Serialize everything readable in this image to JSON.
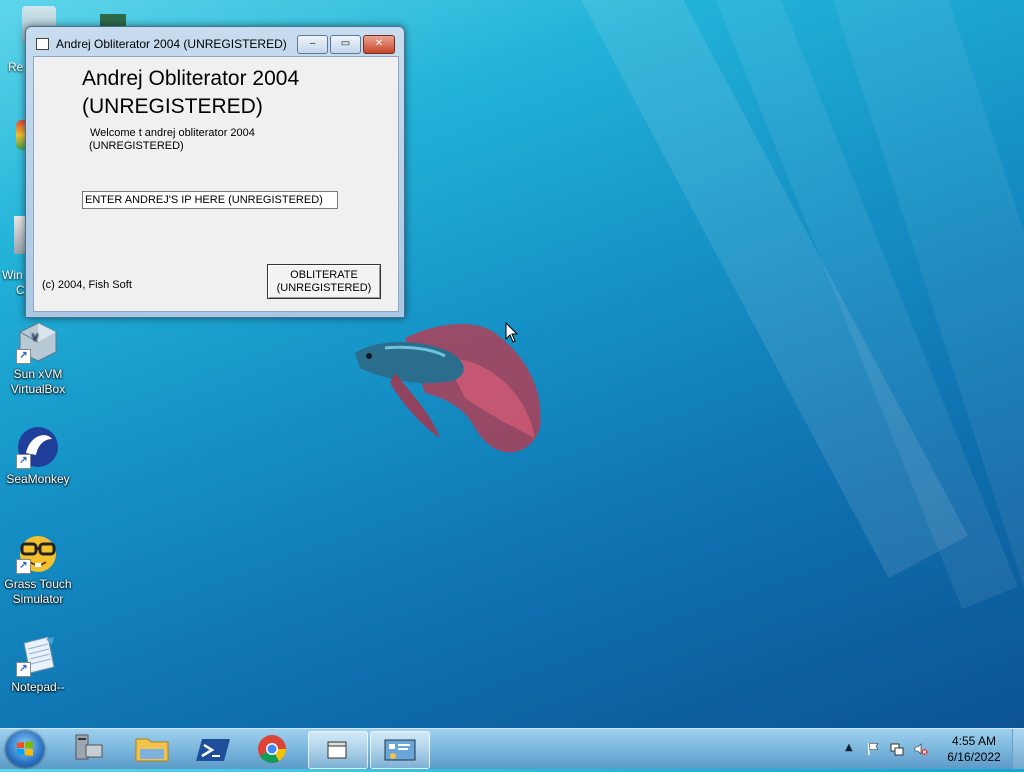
{
  "window": {
    "title": "Andrej Obliterator 2004 (UNREGISTERED)",
    "heading_line1": "Andrej Obliterator 2004",
    "heading_line2": "(UNREGISTERED)",
    "welcome_line1": "Welcome t andrej obliterator 2004",
    "welcome_line2": "(UNREGISTERED)",
    "ip_input_value": "ENTER ANDREJ'S IP HERE (UNREGISTERED)",
    "copyright": "(c) 2004, Fish Soft",
    "button_line1": "OBLITERATE",
    "button_line2": "(UNREGISTERED)",
    "minimize_glyph": "‒",
    "maximize_glyph": "▭",
    "close_glyph": "✕"
  },
  "desktop_icons": [
    {
      "label_line1": "Sun xVM",
      "label_line2": "VirtualBox",
      "icon": "virtualbox-icon"
    },
    {
      "label_line1": "SeaMonkey",
      "label_line2": "",
      "icon": "seamonkey-icon"
    },
    {
      "label_line1": "Grass Touch",
      "label_line2": "Simulator",
      "icon": "nerd-face-icon"
    },
    {
      "label_line1": "Notepad--",
      "label_line2": "",
      "icon": "notepad-icon"
    }
  ],
  "partial_icons": {
    "top": "Re",
    "win_line1": "Win",
    "win_line2": "C"
  },
  "taskbar": {
    "items": [
      "server-manager-icon",
      "file-explorer-icon",
      "powershell-icon",
      "chrome-icon",
      "app-window-icon",
      "control-panel-icon"
    ],
    "time": "4:55 AM",
    "date": "6/16/2022"
  },
  "colors": {
    "desktop_top": "#5fd6ea",
    "desktop_bottom": "#0b4f8f",
    "close_button": "#c8462b"
  }
}
